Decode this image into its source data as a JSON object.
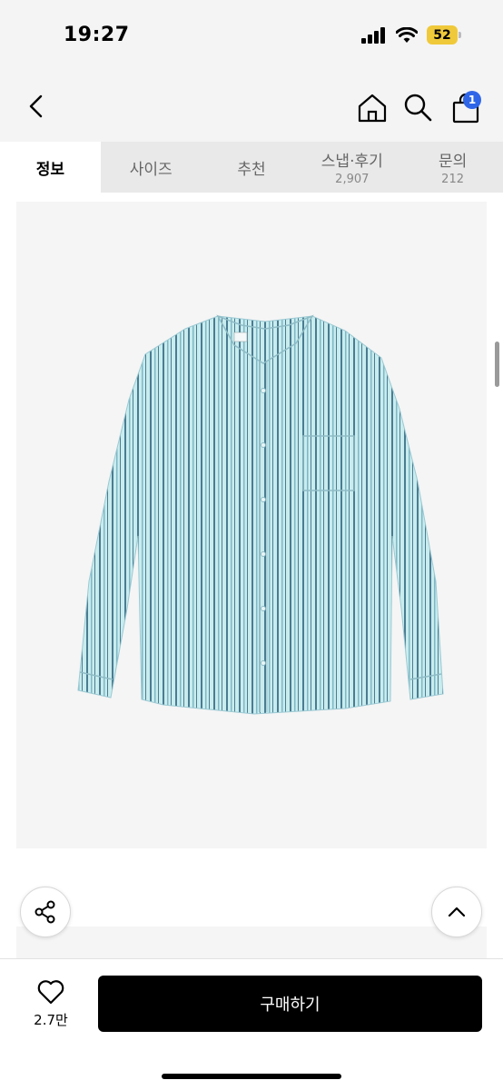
{
  "status_bar": {
    "time": "19:27",
    "battery_level": "52"
  },
  "nav": {
    "cart_count": "1"
  },
  "tabs": [
    {
      "label": "정보",
      "count": ""
    },
    {
      "label": "사이즈",
      "count": ""
    },
    {
      "label": "추천",
      "count": ""
    },
    {
      "label": "스냅·후기",
      "count": "2,907"
    },
    {
      "label": "문의",
      "count": "212"
    }
  ],
  "product": {
    "colors": {
      "shirt_base": "#c9ecee",
      "shirt_stripe": "#4a7c92",
      "shirt_stripe_light": "#7fb7c7"
    }
  },
  "footer": {
    "like_count": "2.7만",
    "buy_label": "구매하기"
  },
  "colors": {
    "badge": "#2f66e8",
    "battery": "#f0c93a",
    "buy_button": "#000000"
  }
}
